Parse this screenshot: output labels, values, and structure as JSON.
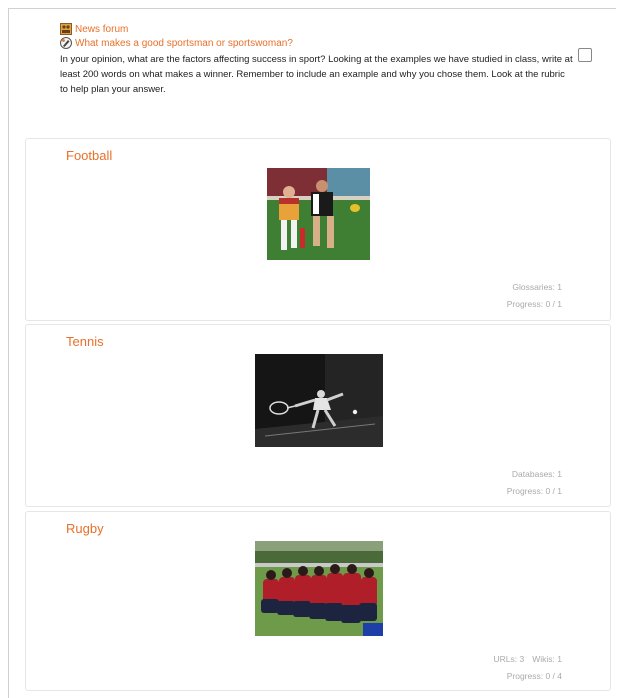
{
  "intro": {
    "forum_link": "News forum",
    "assignment_link": "What makes a good sportsman or sportswoman?",
    "text": "In your opinion, what are the factors affecting success in sport? Looking at the examples we have studied in class, write at least 200 words on what makes a winner. Remember to include an example and why you chose them. Look at the rubric to help plan your answer."
  },
  "sections": [
    {
      "title": "Football",
      "meta": [
        "Glossaries: 1"
      ],
      "progress": "Progress: 0 / 1"
    },
    {
      "title": "Tennis",
      "meta": [
        "Databases: 1"
      ],
      "progress": "Progress: 0 / 1"
    },
    {
      "title": "Rugby",
      "meta": [
        "URLs: 3",
        "Wikis: 1"
      ],
      "progress": "Progress: 0 / 4"
    }
  ],
  "colors": {
    "accent": "#e8702a",
    "muted": "#aaaaaa"
  },
  "icons": [
    "forum-icon",
    "assignment-icon",
    "checkbox-icon"
  ]
}
